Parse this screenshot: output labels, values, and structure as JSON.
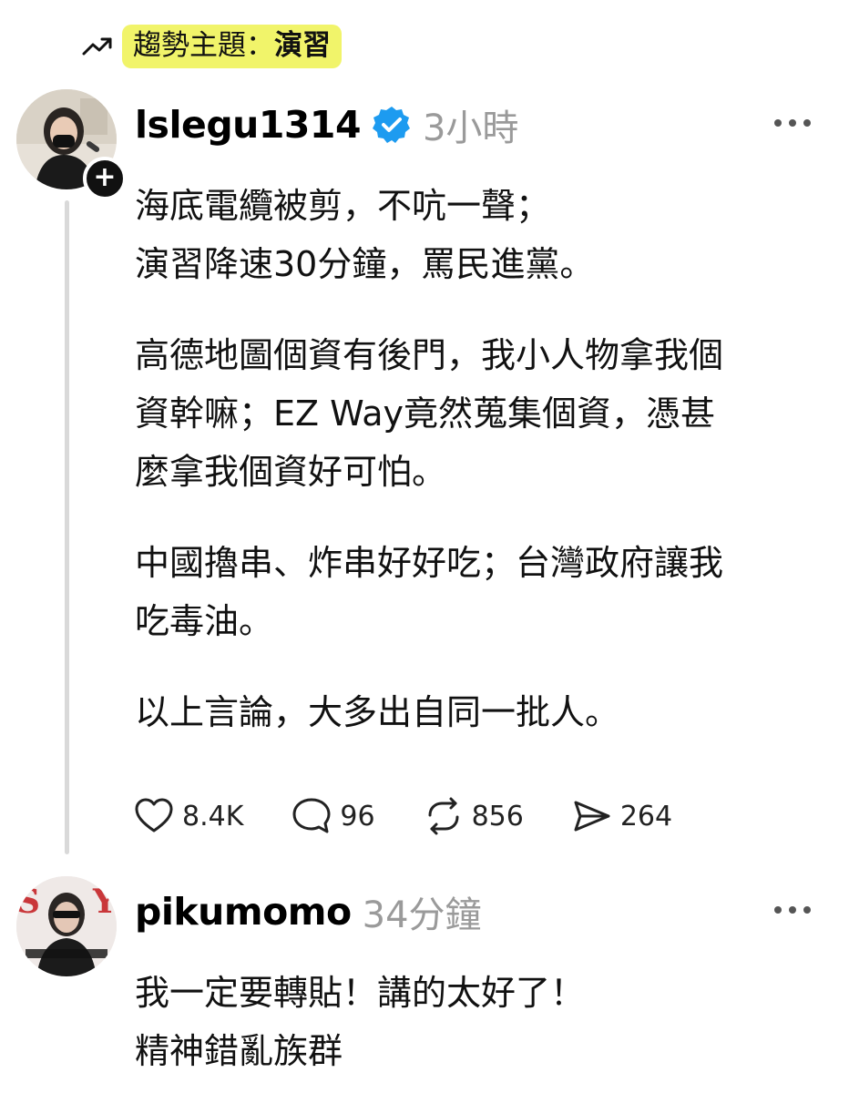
{
  "trending": {
    "prefix": "趨勢主題：",
    "keyword": "演習"
  },
  "post": {
    "username": "lslegu1314",
    "verified": true,
    "time": "3小時",
    "paragraphs": [
      [
        "海底電纜被剪，不吭一聲；",
        "演習降速30分鐘，罵民進黨。"
      ],
      [
        "高德地圖個資有後門，我小人物拿我個",
        "資幹嘛；EZ Way竟然蒐集個資，憑甚",
        "麼拿我個資好可怕。"
      ],
      [
        "中國擼串、炸串好好吃；台灣政府讓我",
        "吃毒油。"
      ],
      [
        "以上言論，大多出自同一批人。"
      ]
    ],
    "stats": {
      "likes": "8.4K",
      "replies": "96",
      "reposts": "856",
      "shares": "264"
    }
  },
  "reply": {
    "username": "pikumomo",
    "time": "34分鐘",
    "lines": [
      "我一定要轉貼！講的太好了！",
      "精神錯亂族群"
    ]
  },
  "icons": {
    "trend": "trending-up-icon",
    "verified": "verified-badge-icon",
    "follow": "plus-icon",
    "more": "more-horizontal-icon",
    "like": "heart-icon",
    "reply": "comment-icon",
    "repost": "repost-icon",
    "share": "send-icon"
  },
  "colors": {
    "trend_highlight": "#f1f46a",
    "verified_blue": "#1d9bf0",
    "muted_text": "#9a9a9a",
    "thread_line": "#d9d9d9"
  }
}
